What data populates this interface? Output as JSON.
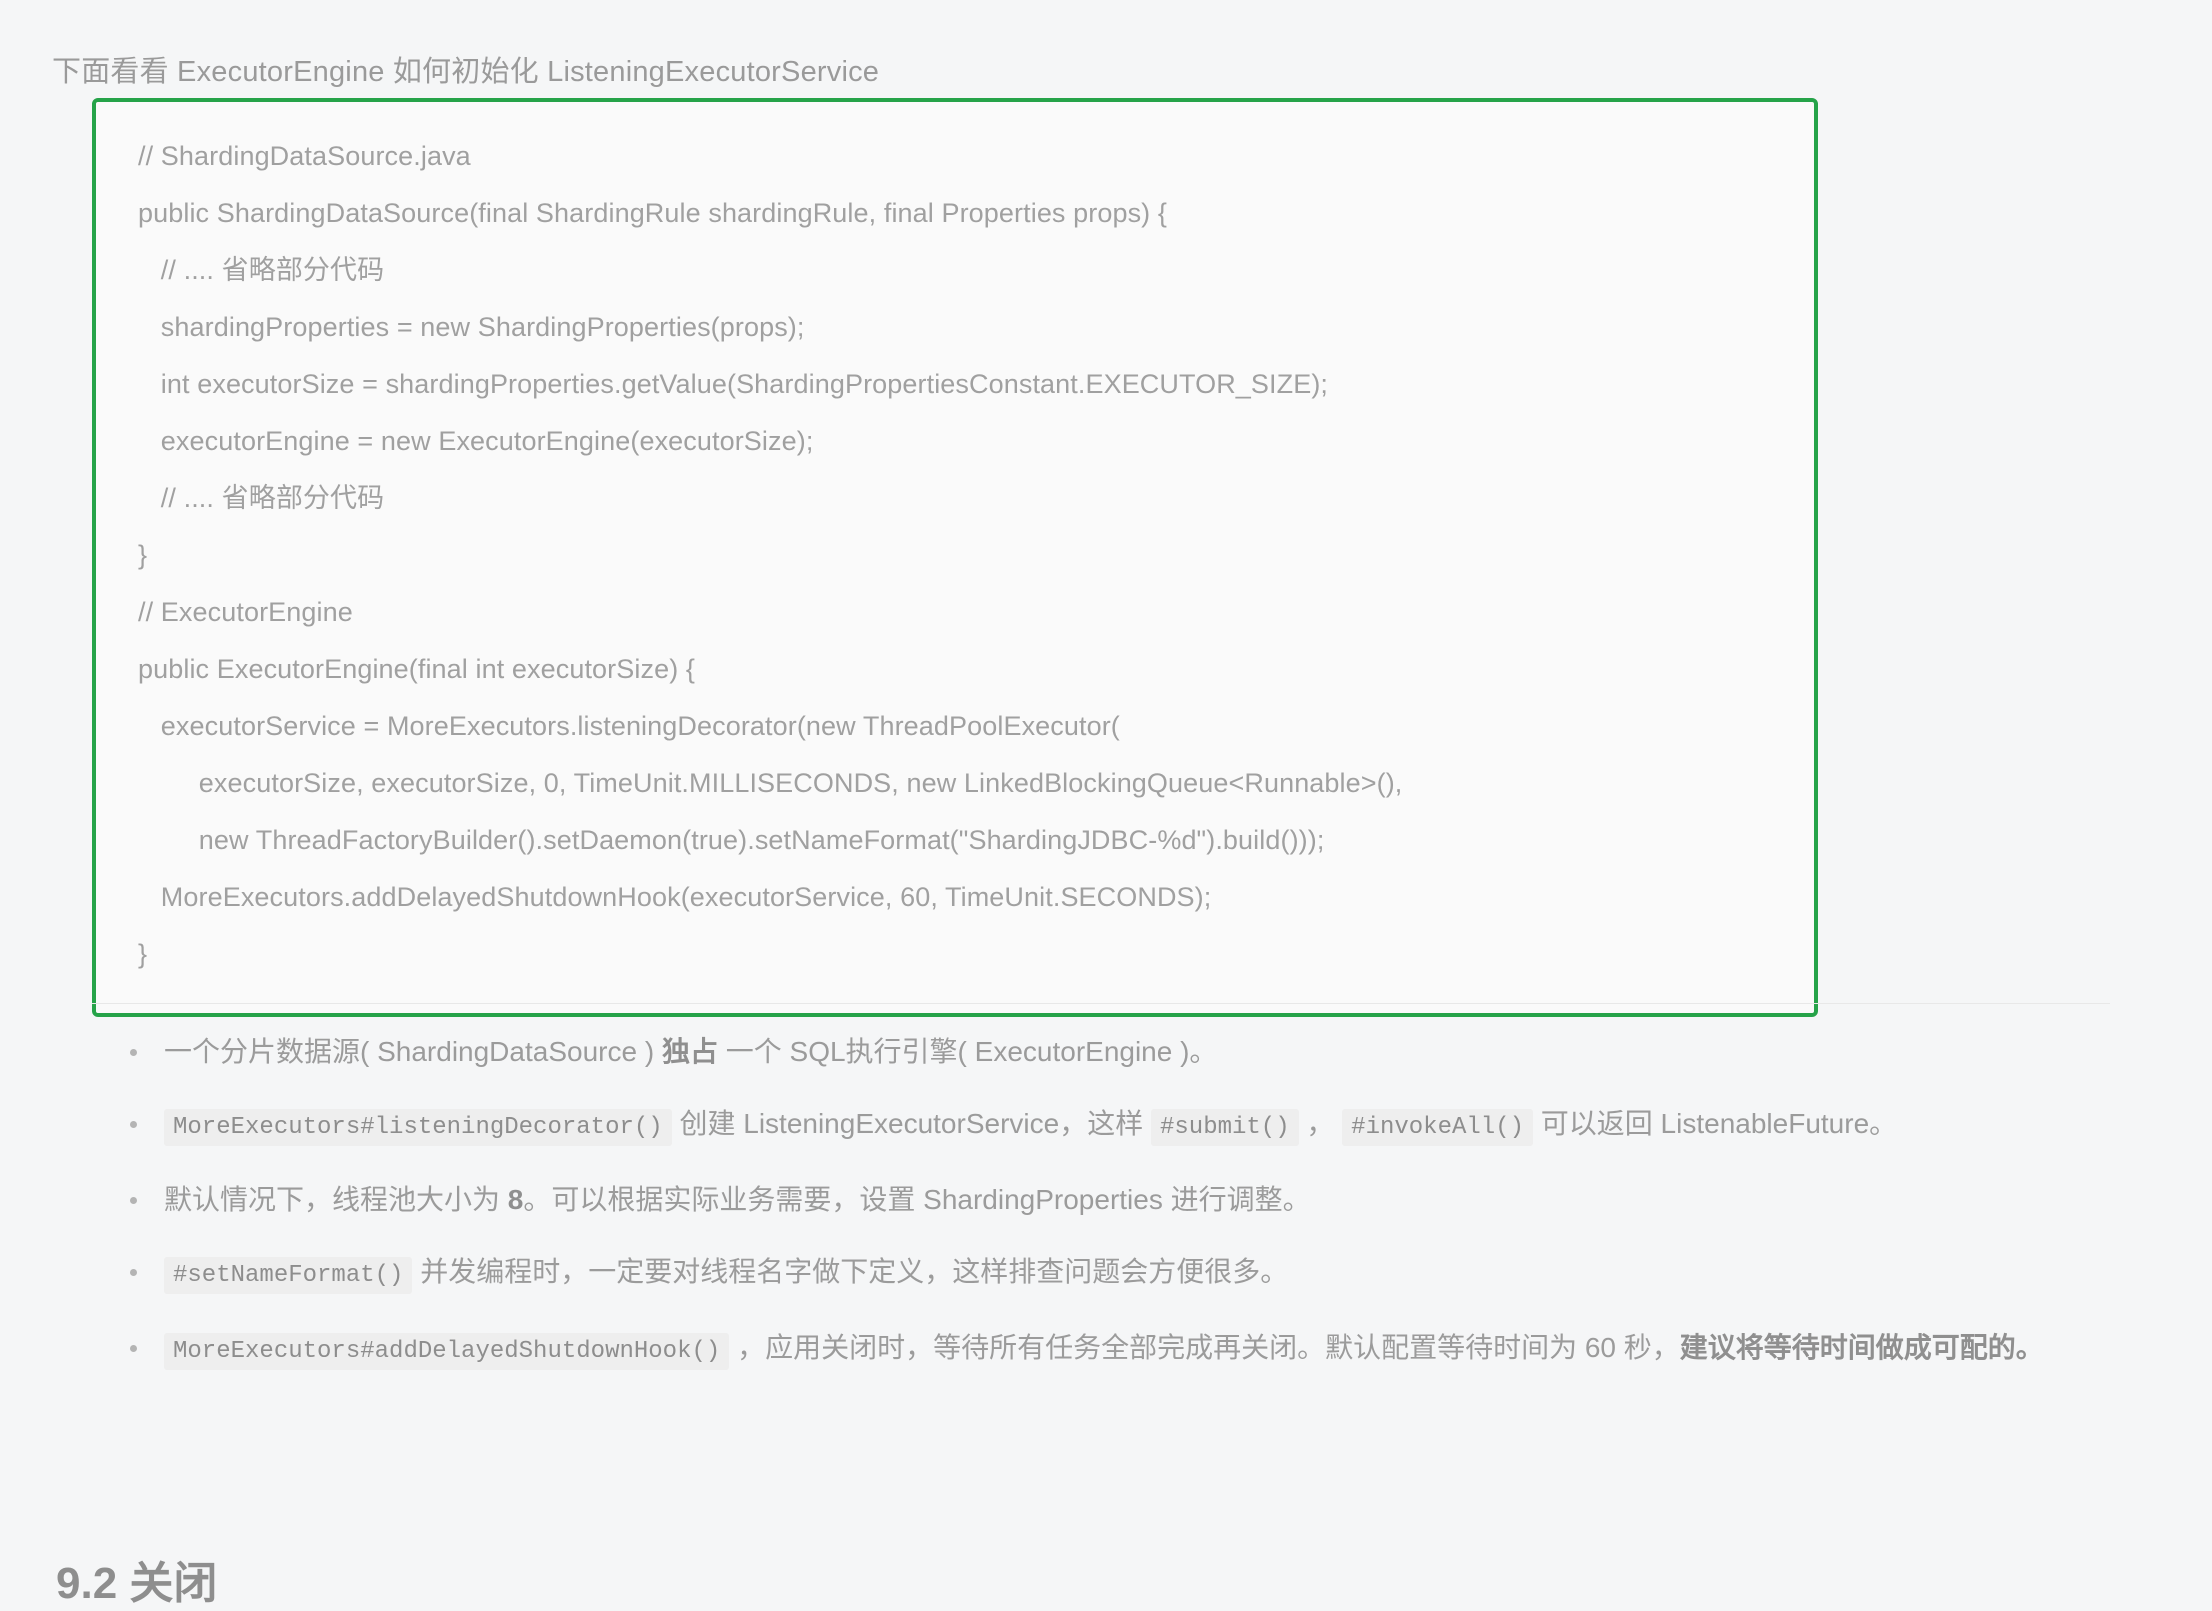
{
  "intro": {
    "text": "下面看看 ExecutorEngine 如何初始化 ListeningExecutorService"
  },
  "code_block": {
    "border_color": "#26a349",
    "background": "#fafafa",
    "language": "java",
    "lines": [
      "// ShardingDataSource.java",
      "public ShardingDataSource(final ShardingRule shardingRule, final Properties props) {",
      "   // .... 省略部分代码",
      "   shardingProperties = new ShardingProperties(props);",
      "   int executorSize = shardingProperties.getValue(ShardingPropertiesConstant.EXECUTOR_SIZE);",
      "   executorEngine = new ExecutorEngine(executorSize);",
      "   // .... 省略部分代码",
      "}",
      "// ExecutorEngine",
      "public ExecutorEngine(final int executorSize) {",
      "   executorService = MoreExecutors.listeningDecorator(new ThreadPoolExecutor(",
      "        executorSize, executorSize, 0, TimeUnit.MILLISECONDS, new LinkedBlockingQueue<Runnable>(),",
      "        new ThreadFactoryBuilder().setDaemon(true).setNameFormat(\"ShardingJDBC-%d\").build()));",
      "   MoreExecutors.addDelayedShutdownHook(executorService, 60, TimeUnit.SECONDS);",
      "}"
    ]
  },
  "bullets": [
    {
      "id": "bullet-sharding-datasource",
      "parts": [
        {
          "type": "text",
          "value": "一个分片数据源( ShardingDataSource ) "
        },
        {
          "type": "strong",
          "value": "独占"
        },
        {
          "type": "text",
          "value": " 一个 SQL执行引擎( ExecutorEngine )。"
        }
      ]
    },
    {
      "id": "bullet-listening-decorator",
      "parts": [
        {
          "type": "code",
          "value": "MoreExecutors#listeningDecorator()"
        },
        {
          "type": "text",
          "value": " 创建 ListeningExecutorService，这样 "
        },
        {
          "type": "code",
          "value": "#submit()"
        },
        {
          "type": "text",
          "value": " ， "
        },
        {
          "type": "code",
          "value": "#invokeAll()"
        },
        {
          "type": "text",
          "value": " 可以返回 ListenableFuture。"
        }
      ]
    },
    {
      "id": "bullet-default-pool-size",
      "parts": [
        {
          "type": "text",
          "value": "默认情况下，线程池大小为 "
        },
        {
          "type": "strong",
          "value": "8"
        },
        {
          "type": "text",
          "value": "。可以根据实际业务需要，设置 ShardingProperties 进行调整。"
        }
      ]
    },
    {
      "id": "bullet-set-name-format",
      "parts": [
        {
          "type": "code",
          "value": "#setNameFormat()"
        },
        {
          "type": "text",
          "value": " 并发编程时，一定要对线程名字做下定义，这样排查问题会方便很多。"
        }
      ]
    },
    {
      "id": "bullet-add-delayed-shutdown-hook",
      "parts": [
        {
          "type": "code",
          "value": "MoreExecutors#addDelayedShutdownHook()"
        },
        {
          "type": "text",
          "value": " ，应用关闭时，等待所有任务全部完成再关闭。默认配置等待时间为 60 秒，"
        },
        {
          "type": "strong",
          "value": "建议将等待时间做成可配的。"
        }
      ]
    }
  ],
  "next_heading": {
    "text": "9.2 关闭"
  }
}
